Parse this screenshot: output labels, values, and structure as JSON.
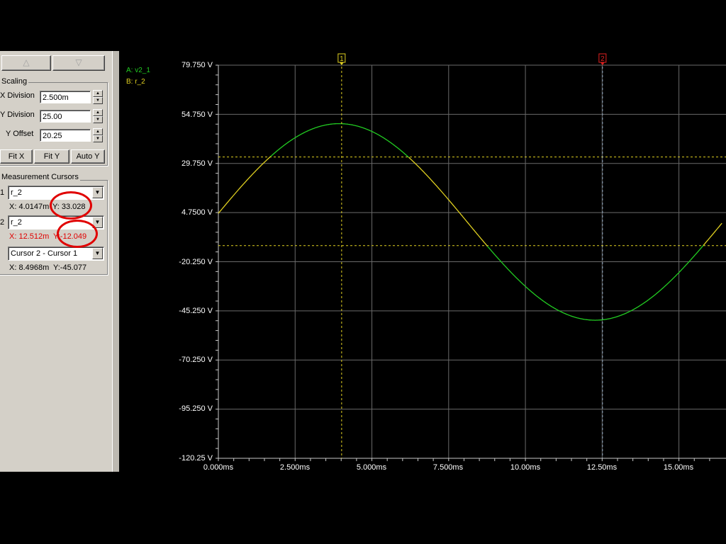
{
  "panel": {
    "scroll_up_icon": "triangle-up-icon",
    "scroll_down_icon": "triangle-down-icon",
    "scaling": {
      "title": "Scaling",
      "x_division_label": "X Division",
      "x_division_value": "2.500m",
      "y_division_label": "Y Division",
      "y_division_value": "25.00",
      "y_offset_label": "Y Offset",
      "y_offset_value": "20.25",
      "fit_x": "Fit X",
      "fit_y": "Fit Y",
      "auto_y": "Auto Y"
    },
    "cursors": {
      "title": "Measurement Cursors",
      "cursor1": {
        "index": "1",
        "trace": "r_2",
        "x": "X: 4.0147m",
        "y": "Y: 33.028"
      },
      "cursor2": {
        "index": "2",
        "trace": "r_2",
        "x": "X: 12.512m",
        "y": "Y:-12.049"
      },
      "diff": {
        "selection": "Cursor 2 - Cursor 1",
        "x": "X: 8.4968m",
        "y": "Y:-45.077"
      }
    }
  },
  "legend": {
    "a": "A: v2_1",
    "b": "B: r_2",
    "a_color": "#22cc22",
    "b_color": "#e0d020"
  },
  "cursor_markers": {
    "c1": "1",
    "c2": "2",
    "c1_color": "#e0d020",
    "c2_color": "#e02020"
  },
  "chart_data": {
    "type": "line",
    "title": "",
    "xlabel": "",
    "ylabel": "",
    "x_ticks": [
      "0.000ms",
      "2.500ms",
      "5.000ms",
      "7.500ms",
      "10.00ms",
      "12.50ms",
      "15.00ms"
    ],
    "y_ticks": [
      "79.750 V",
      "54.750 V",
      "29.750 V",
      "4.7500 V",
      "-20.250 V",
      "-45.250 V",
      "-70.250 V",
      "-95.250 V",
      "-120.25 V"
    ],
    "xlim": [
      0,
      16.4
    ],
    "ylim": [
      -120.25,
      79.75
    ],
    "grid": true,
    "series": [
      {
        "name": "v2_1",
        "color": "#22cc22",
        "amplitude": 50,
        "offset": 0,
        "frequency_hz": 60,
        "phase_deg": 5
      },
      {
        "name": "r_2",
        "color": "#e0d020",
        "shown_when_between": [
          -12.049,
          33.028
        ]
      }
    ],
    "cursors": [
      {
        "label": "1",
        "x_ms": 4.0147,
        "y": 33.028
      },
      {
        "label": "2",
        "x_ms": 12.512,
        "y": -12.049
      }
    ]
  }
}
